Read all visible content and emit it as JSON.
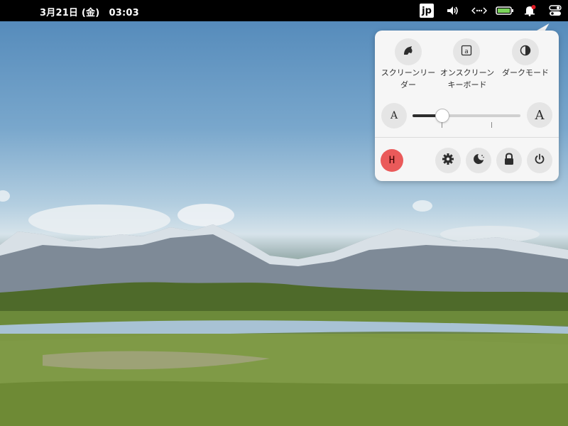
{
  "topbar": {
    "clock": "3月21日 (金)　03:03",
    "keyboard_layout": "jp",
    "icons": [
      "volume-icon",
      "network-wired-icon",
      "battery-icon",
      "notification-bell-icon",
      "system-menu-icon"
    ]
  },
  "quick_settings": {
    "accessibility": [
      {
        "name": "screen-reader",
        "label_line1": "スクリーンリー",
        "label_line2": "ダー",
        "icon": "screen-reader-icon"
      },
      {
        "name": "on-screen-keyboard",
        "label_line1": "オンスクリーン",
        "label_line2": "キーボード",
        "icon": "keyboard-icon"
      },
      {
        "name": "dark-mode",
        "label_line1": "ダークモード",
        "label_line2": "",
        "icon": "dark-mode-icon"
      }
    ],
    "text_size": {
      "smaller_label": "A",
      "larger_label": "A",
      "value_fraction": 0.27
    },
    "user_avatar": "H",
    "actions": [
      "settings-icon",
      "night-light-icon",
      "lock-icon",
      "power-icon"
    ]
  },
  "colors": {
    "topbar": "#000000",
    "menu_bg": "#f6f6f6",
    "button_bg": "#e5e5e5",
    "avatar": "#ea5a5a",
    "battery": "#7ad45a",
    "notification_dot": "#e01b24"
  }
}
